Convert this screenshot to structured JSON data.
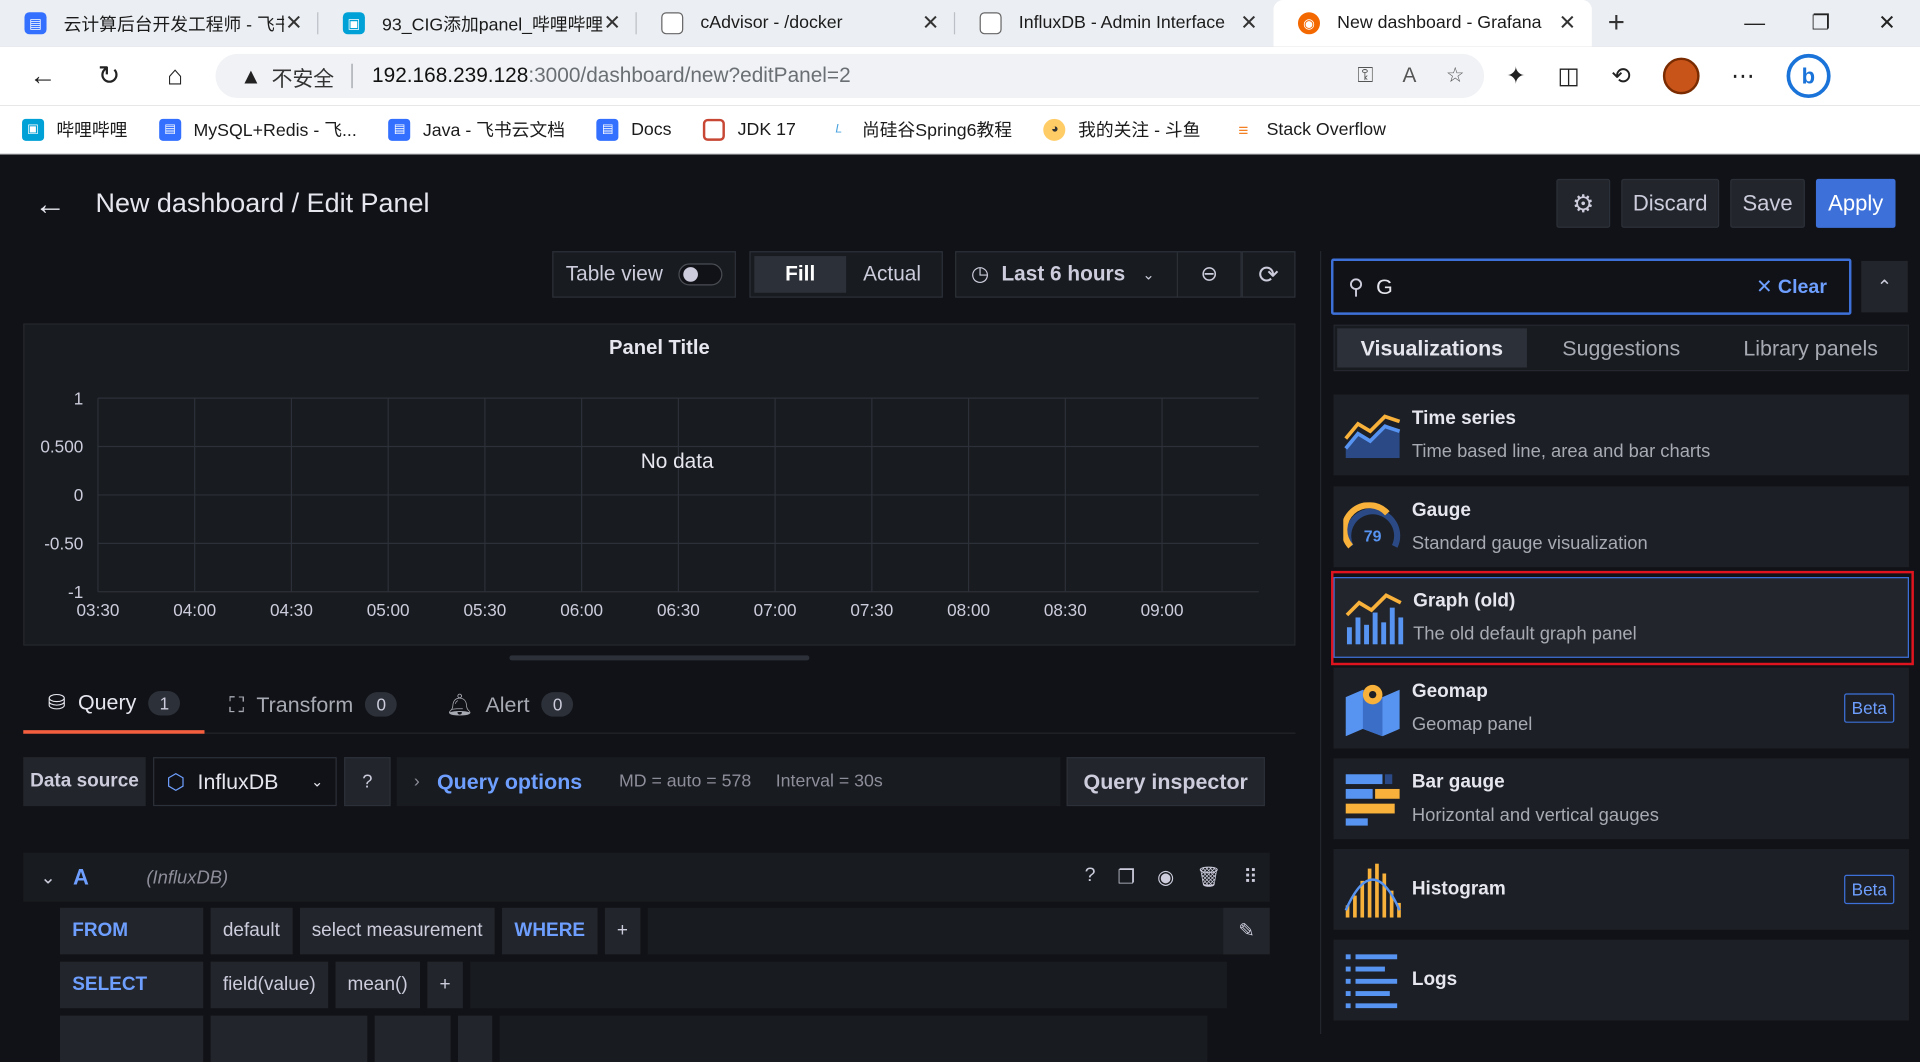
{
  "browser": {
    "tabs": [
      {
        "title": "云计算后台开发工程师 - 飞书",
        "icon_color": "#3370ff",
        "active": false
      },
      {
        "title": "93_CIG添加panel_哔哩哔哩",
        "icon_color": "#00a1d6",
        "active": false
      },
      {
        "title": "cAdvisor - /docker",
        "icon_color": "#666666",
        "active": false
      },
      {
        "title": "InfluxDB - Admin Interface",
        "icon_color": "#666666",
        "active": false
      },
      {
        "title": "New dashboard - Grafana",
        "icon_color": "#f46800",
        "active": true
      }
    ],
    "address": {
      "warning": "不安全",
      "host": "192.168.239.128",
      "path": ":3000/dashboard/new?editPanel=2"
    },
    "bookmarks": [
      {
        "label": "哔哩哔哩",
        "icon_color": "#00a1d6"
      },
      {
        "label": "MySQL+Redis - 飞...",
        "icon_color": "#3370ff"
      },
      {
        "label": "Java - 飞书云文档",
        "icon_color": "#3370ff"
      },
      {
        "label": "Docs",
        "icon_color": "#3370ff"
      },
      {
        "label": "JDK 17",
        "icon_color": "#c74634"
      },
      {
        "label": "尚硅谷Spring6教程",
        "icon_color": "#4aa3df"
      },
      {
        "label": "我的关注 - 斗鱼",
        "icon_color": "#ff7700"
      },
      {
        "label": "Stack Overflow",
        "icon_color": "#f48024"
      }
    ]
  },
  "header": {
    "title": "New dashboard / Edit Panel",
    "discard": "Discard",
    "save": "Save",
    "apply": "Apply"
  },
  "toolbar": {
    "table_view": "Table view",
    "fill": "Fill",
    "actual": "Actual",
    "time_range": "Last 6 hours"
  },
  "panel": {
    "title": "Panel Title",
    "no_data": "No data"
  },
  "chart_data": {
    "type": "line",
    "title": "Panel Title",
    "x_ticks": [
      "03:30",
      "04:00",
      "04:30",
      "05:00",
      "05:30",
      "06:00",
      "06:30",
      "07:00",
      "07:30",
      "08:00",
      "08:30",
      "09:00"
    ],
    "y_ticks": [
      "1",
      "0.500",
      "0",
      "-0.50",
      "-1"
    ],
    "ylim": [
      -1,
      1
    ],
    "series": [],
    "annotation": "No data",
    "grid": true
  },
  "query_tabs": [
    {
      "label": "Query",
      "count": "1",
      "active": true
    },
    {
      "label": "Transform",
      "count": "0",
      "active": false
    },
    {
      "label": "Alert",
      "count": "0",
      "active": false
    }
  ],
  "datasource": {
    "label": "Data source",
    "value": "InfluxDB",
    "query_options": "Query options",
    "md": "MD = auto = 578",
    "interval": "Interval = 30s",
    "inspector": "Query inspector"
  },
  "query": {
    "letter": "A",
    "source": "(InfluxDB)",
    "from": {
      "kw": "FROM",
      "policy": "default",
      "measurement": "select measurement",
      "where": "WHERE",
      "plus": "+"
    },
    "select": {
      "kw": "SELECT",
      "field": "field(value)",
      "agg": "mean()",
      "plus": "+"
    }
  },
  "viz": {
    "search_value": "G",
    "clear": "Clear",
    "tabs": [
      "Visualizations",
      "Suggestions",
      "Library panels"
    ],
    "items": [
      {
        "name": "Time series",
        "desc": "Time based line, area and bar charts",
        "beta": ""
      },
      {
        "name": "Gauge",
        "desc": "Standard gauge visualization",
        "beta": "",
        "gauge_value": "79"
      },
      {
        "name": "Graph (old)",
        "desc": "The old default graph panel",
        "beta": ""
      },
      {
        "name": "Geomap",
        "desc": "Geomap panel",
        "beta": "Beta"
      },
      {
        "name": "Bar gauge",
        "desc": "Horizontal and vertical gauges",
        "beta": ""
      },
      {
        "name": "Histogram",
        "desc": "",
        "beta": "Beta"
      },
      {
        "name": "Logs",
        "desc": "",
        "beta": ""
      }
    ]
  }
}
